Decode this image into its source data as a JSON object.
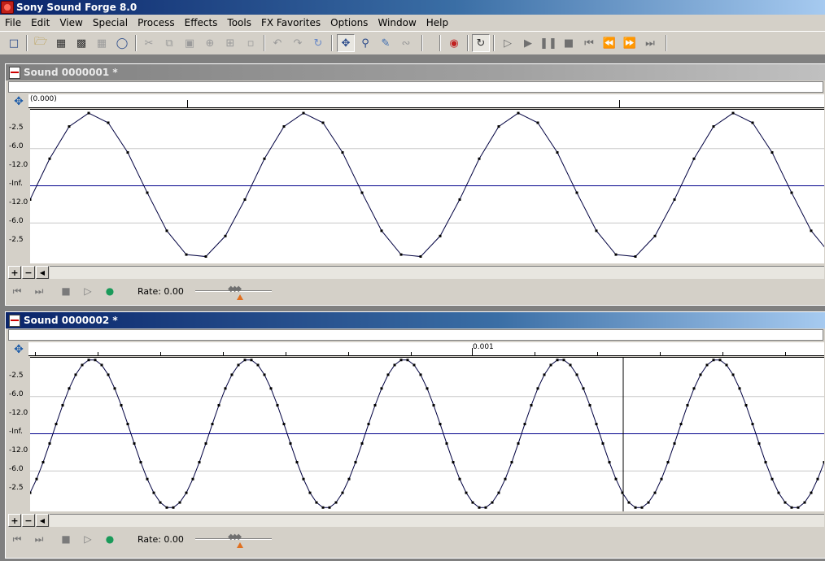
{
  "app": {
    "title": "Sony Sound Forge 8.0"
  },
  "menu": [
    "File",
    "Edit",
    "View",
    "Special",
    "Process",
    "Effects",
    "Tools",
    "FX Favorites",
    "Options",
    "Window",
    "Help"
  ],
  "toolbar": {
    "icons": [
      "new-icon",
      "open-icon",
      "save-icon",
      "save-as-icon",
      "save-all-icon",
      "web-icon",
      "cut-icon",
      "copy-icon",
      "paste-icon",
      "paste-mix-icon",
      "paste-crossfade-icon",
      "trim-icon",
      "undo-icon",
      "redo-icon",
      "repeat-icon",
      "edit-tool-icon",
      "magnify-tool-icon",
      "pencil-tool-icon",
      "envelope-tool-icon",
      "record-icon",
      "loop-icon",
      "play-all-icon",
      "play-icon",
      "pause-icon",
      "stop-icon",
      "go-start-icon",
      "rewind-icon",
      "forward-icon",
      "go-end-icon"
    ]
  },
  "windows": [
    {
      "title": "Sound 0000001 *",
      "state": "inactive",
      "ruler_label": "(0.000)",
      "db_labels": [
        "-2.5",
        "-6.0",
        "-12.0",
        "-Inf.",
        "-12.0",
        "-6.0",
        "-2.5"
      ],
      "rate_label": "Rate: 0.00",
      "wave": "coarse-sine"
    },
    {
      "title": "Sound 0000002 *",
      "state": "active",
      "ruler_label": "0.001",
      "db_labels": [
        "-2.5",
        "-6.0",
        "-12.0",
        "-Inf.",
        "-12.0",
        "-6.0",
        "-2.5"
      ],
      "rate_label": "Rate: 0.00",
      "wave": "fine-sine"
    }
  ],
  "colors": {
    "waveform": "#000040",
    "center_line": "#00008b",
    "active_title": "#0a246a"
  }
}
